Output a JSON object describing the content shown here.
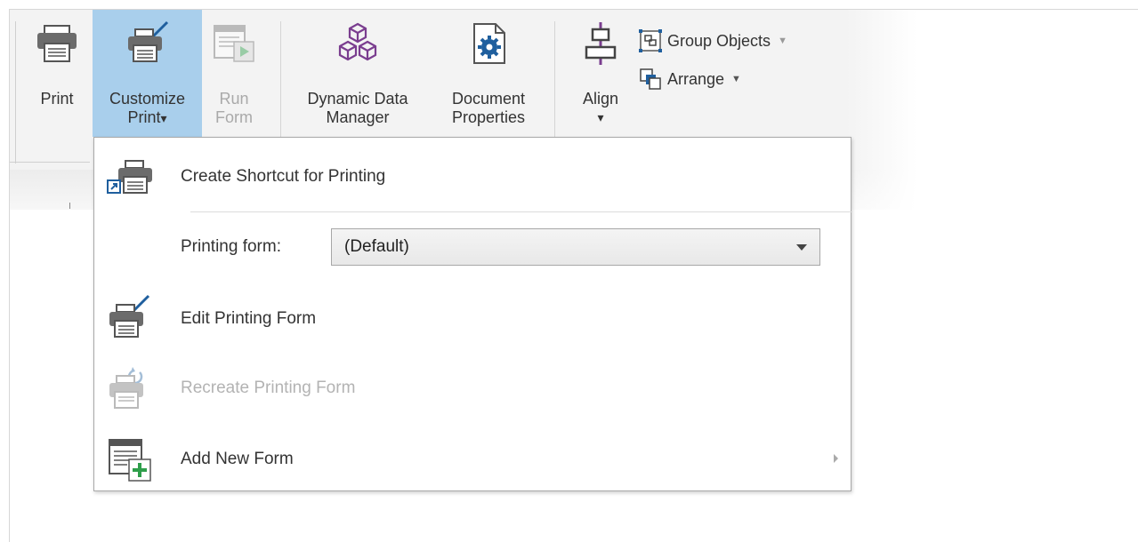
{
  "ribbon": {
    "print": {
      "label": "Print",
      "icon": "printer-icon"
    },
    "customize_print": {
      "label_line1": "Customize",
      "label_line2": "Print",
      "icon": "printer-paintbrush-icon",
      "caret": "▾"
    },
    "run_form": {
      "label_line1": "Run",
      "label_line2": "Form",
      "icon": "run-form-icon"
    },
    "dynamic_data_manager": {
      "label_line1": "Dynamic Data",
      "label_line2": "Manager",
      "icon": "cubes-icon"
    },
    "document_properties": {
      "label_line1": "Document",
      "label_line2": "Properties",
      "icon": "document-gear-icon"
    },
    "align": {
      "label": "Align",
      "caret": "▾",
      "icon": "align-center-icon"
    },
    "group_objects": {
      "label": "Group Objects",
      "caret": "▼",
      "icon": "group-objects-icon"
    },
    "arrange": {
      "label": "Arrange",
      "caret": "▼",
      "icon": "arrange-icon"
    }
  },
  "menu": {
    "create_shortcut": {
      "label": "Create Shortcut for Printing",
      "icon": "printer-shortcut-icon"
    },
    "printing_form": {
      "label": "Printing form:",
      "selected": "(Default)"
    },
    "edit_form": {
      "label": "Edit Printing Form",
      "icon": "printer-paintbrush-icon"
    },
    "recreate_form": {
      "label": "Recreate Printing Form",
      "icon": "printer-refresh-icon",
      "disabled": true
    },
    "add_new_form": {
      "label": "Add New Form",
      "icon": "add-form-icon"
    }
  },
  "colors": {
    "active_button": "#a9cfec",
    "brand_blue": "#1f5f9e",
    "purple": "#7a3d8f",
    "green": "#2e9e4a"
  }
}
